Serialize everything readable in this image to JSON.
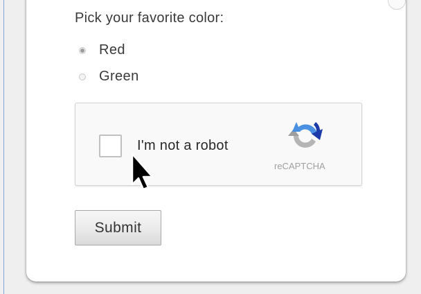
{
  "form": {
    "question": "Pick your favorite color:",
    "options": [
      {
        "label": "Red",
        "checked": true
      },
      {
        "label": "Green",
        "checked": false
      }
    ]
  },
  "captcha": {
    "checkbox_label": "I'm not a robot",
    "checked": false,
    "brand": "reCAPTCHA",
    "logo_icon": "recaptcha-logo-icon",
    "logo_colors": {
      "blue": "#4a90e2",
      "dark_blue": "#1c3aa9",
      "gray": "#b5b5b5"
    }
  },
  "submit": {
    "label": "Submit"
  },
  "pointer": {
    "icon": "mouse-pointer-icon"
  }
}
